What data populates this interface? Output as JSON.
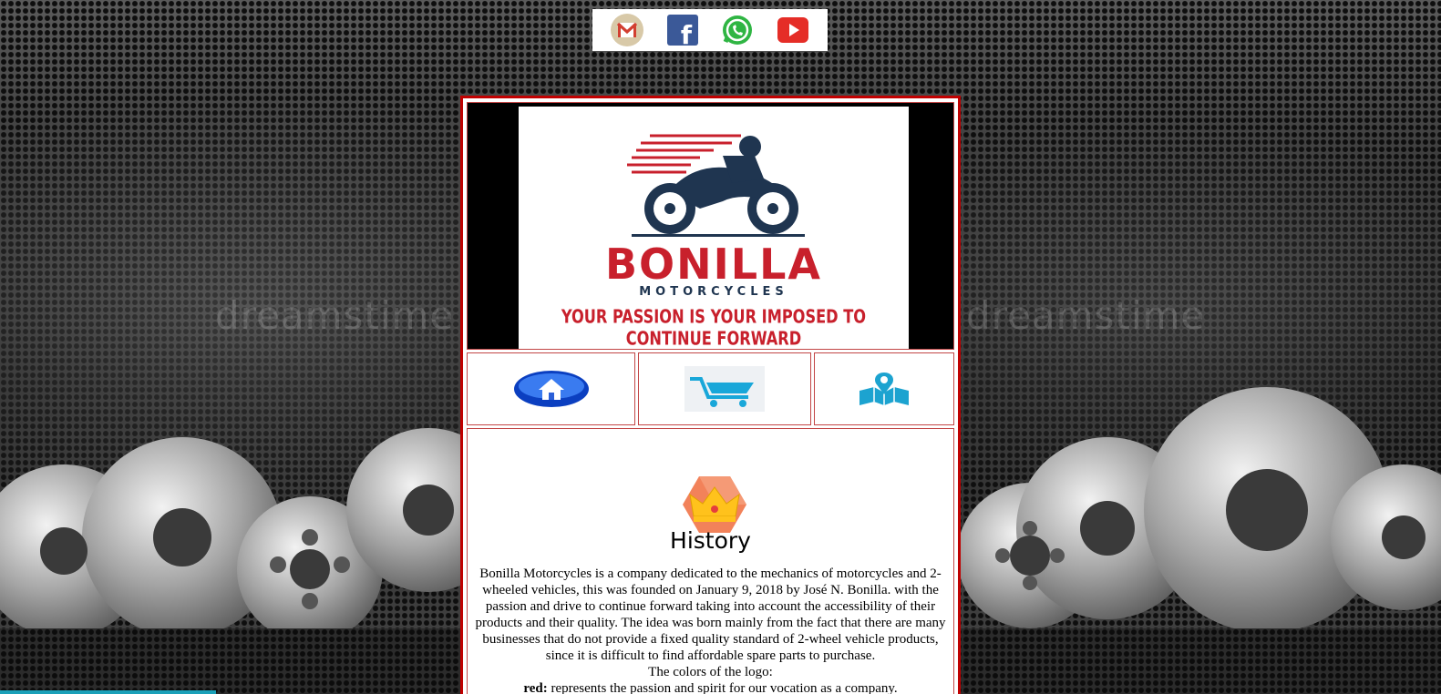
{
  "watermark": {
    "text": "dreamstime"
  },
  "social": {
    "items": [
      {
        "name": "gmail",
        "icon": "gmail-icon"
      },
      {
        "name": "facebook",
        "icon": "facebook-icon",
        "glyph": "f"
      },
      {
        "name": "whatsapp",
        "icon": "whatsapp-icon"
      },
      {
        "name": "youtube",
        "icon": "youtube-icon"
      }
    ]
  },
  "logo": {
    "brand": "BONILLA",
    "subtitle": "MOTORCYCLES",
    "tagline": "YOUR PASSION IS YOUR IMPOSED TO CONTINUE FORWARD",
    "colors": {
      "red": "#c8202c",
      "navy": "#1f3550"
    }
  },
  "nav": {
    "items": [
      {
        "id": "home",
        "icon": "home-icon"
      },
      {
        "id": "cart",
        "icon": "shopping-cart-icon"
      },
      {
        "id": "location",
        "icon": "map-location-icon"
      }
    ]
  },
  "history": {
    "icon": "crown-icon",
    "title": "History",
    "paragraph": "Bonilla Motorcycles is a company dedicated to the mechanics of motorcycles and 2-wheeled vehicles, this was founded on January 9, 2018 by José N. Bonilla. with the passion and drive to continue forward taking into account the accessibility of their products and their quality. The idea was born mainly from the fact that there are many businesses that do not provide a fixed quality standard of 2-wheel vehicle products, since it is difficult to find affordable spare parts to purchase.",
    "colors_heading": "The colors of the logo:",
    "red_label": "red:",
    "red_text": " represents the passion and spirit for our vocation as a company."
  },
  "theme": {
    "border": "#c00000",
    "accent": "#1aa0b8"
  }
}
